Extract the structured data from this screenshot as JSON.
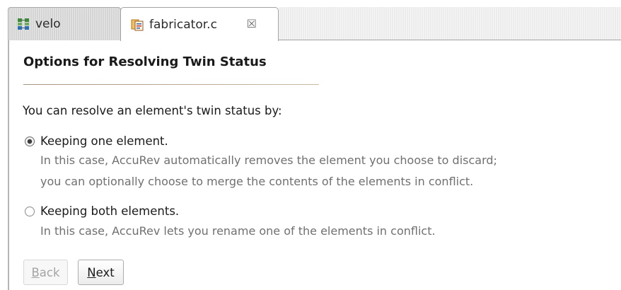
{
  "tabs": [
    {
      "label": "velo",
      "icon": "package-icon",
      "active": false
    },
    {
      "label": "fabricator.c",
      "icon": "c-file-icon",
      "active": true
    }
  ],
  "close_glyph": "☒",
  "panel": {
    "title": "Options for Resolving Twin Status",
    "intro": "You can resolve an element's twin status by:",
    "options": [
      {
        "label": "Keeping one element.",
        "selected": true,
        "description": [
          "In this case, AccuRev automatically removes the element you choose to discard;",
          "you can optionally choose to merge the contents of the elements in conflict."
        ]
      },
      {
        "label": "Keeping both elements.",
        "selected": false,
        "description": [
          "In this case, AccuRev lets you rename one of the elements in conflict."
        ]
      }
    ]
  },
  "buttons": {
    "back": {
      "mnemonic": "B",
      "rest": "ack",
      "enabled": false
    },
    "next": {
      "mnemonic": "N",
      "rest": "ext",
      "enabled": true
    }
  },
  "colors": {
    "description_text": "#707070",
    "divider": "#a9957f",
    "disabled_text": "#a4a4a4"
  }
}
